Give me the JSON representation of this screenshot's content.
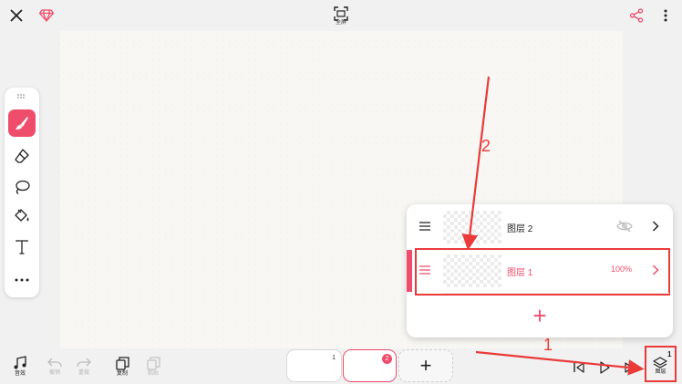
{
  "colors": {
    "accent": "#ef4d6c",
    "annotation": "#ea3a3a"
  },
  "top": {
    "fullscreen_label": "全屏"
  },
  "tools": [
    "brush-icon",
    "eraser-icon",
    "lasso-icon",
    "fill-bucket-icon",
    "text-icon",
    "more-icon"
  ],
  "bottom": {
    "music_label": "音效",
    "undo_label": "撤销",
    "redo_label": "重做",
    "copy_label": "复制",
    "paste_label": "粘贴",
    "layers_label": "图层",
    "layers_count": "1"
  },
  "frames": [
    {
      "number": "1"
    },
    {
      "number": "2"
    }
  ],
  "frame_add_label": "+",
  "layers": [
    {
      "name": "图层 2",
      "opacity": ""
    },
    {
      "name": "图层 1",
      "opacity": "100%"
    }
  ],
  "add_layer_label": "+",
  "annotations": {
    "one": "1",
    "two": "2"
  }
}
